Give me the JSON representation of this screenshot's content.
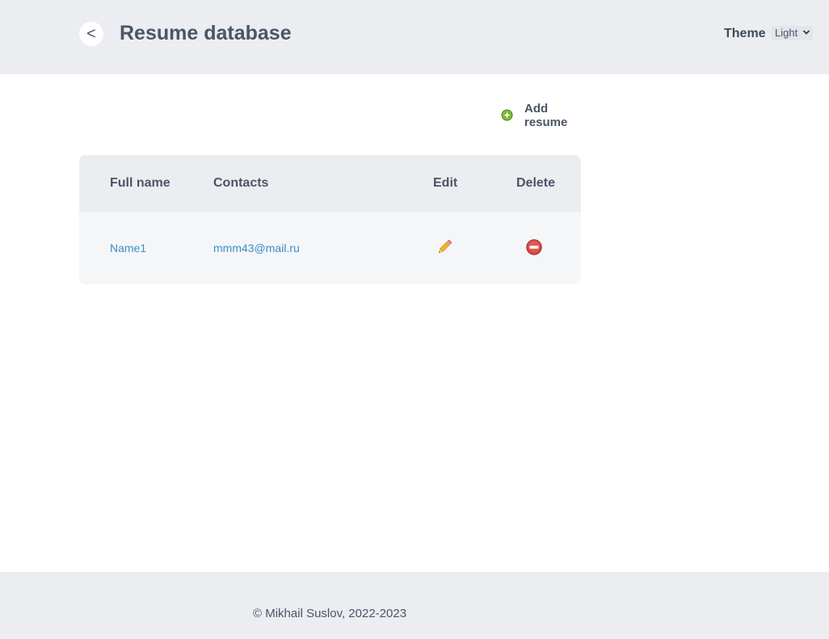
{
  "header": {
    "back_label": "<",
    "title": "Resume database",
    "theme_label": "Theme",
    "theme_selected": "Light"
  },
  "actions": {
    "add_resume_label": "Add resume",
    "add_icon": "plus-circle-icon"
  },
  "table": {
    "columns": [
      "Full name",
      "Contacts",
      "Edit",
      "Delete"
    ],
    "rows": [
      {
        "full_name": "Name1",
        "contacts": "mmm43@mail.ru",
        "edit_icon": "pencil-icon",
        "delete_icon": "no-entry-icon"
      }
    ]
  },
  "footer": {
    "copyright": "© Mikhail Suslov, 2022-2023"
  },
  "colors": {
    "header_bg": "#ebedf0",
    "text": "#4a5568",
    "link": "#3a8fc7",
    "add_green": "#6aab1e",
    "delete_red": "#d9463e"
  }
}
